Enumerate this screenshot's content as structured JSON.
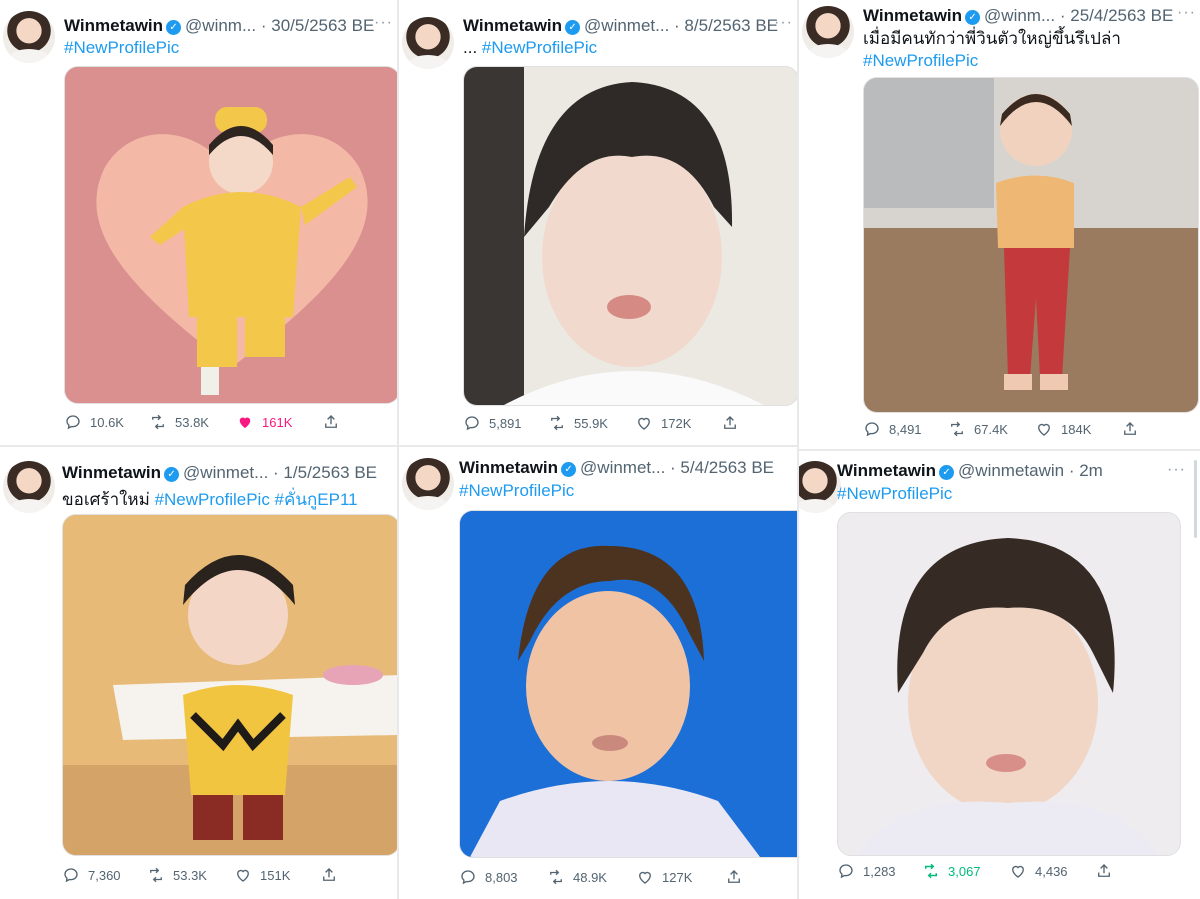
{
  "tweets": [
    {
      "name": "Winmetawin",
      "handle": "@winm...",
      "date": "· 30/5/2563 BE",
      "text_prefix": "",
      "hashtags": "#NewProfilePic",
      "stats": {
        "replies": "10.6K",
        "retweets": "53.8K",
        "likes": "161K"
      },
      "liked": true,
      "retweeted": false
    },
    {
      "name": "Winmetawin",
      "handle": "@winmet...",
      "date": "· 8/5/2563 BE",
      "text_prefix": "...",
      "hashtags": "#NewProfilePic",
      "stats": {
        "replies": "5,891",
        "retweets": "55.9K",
        "likes": "172K"
      },
      "liked": false,
      "retweeted": false
    },
    {
      "name": "Winmetawin",
      "handle": "@winm...",
      "date": "· 25/4/2563 BE",
      "text_prefix": "เมื่อมีคนทักว่าพี่วินตัวใหญ่ขึ้นรึเปล่า",
      "hashtags": "#NewProfilePic",
      "stats": {
        "replies": "8,491",
        "retweets": "67.4K",
        "likes": "184K"
      },
      "liked": false,
      "retweeted": false
    },
    {
      "name": "Winmetawin",
      "handle": "@winmet...",
      "date": "· 1/5/2563 BE",
      "text_prefix": "ขอเศร้าใหม่",
      "hashtags": "#NewProfilePic #คั่นกูEP11",
      "stats": {
        "replies": "7,360",
        "retweets": "53.3K",
        "likes": "151K"
      },
      "liked": false,
      "retweeted": false
    },
    {
      "name": "Winmetawin",
      "handle": "@winmet...",
      "date": "· 5/4/2563 BE",
      "text_prefix": "",
      "hashtags": "#NewProfilePic",
      "stats": {
        "replies": "8,803",
        "retweets": "48.9K",
        "likes": "127K"
      },
      "liked": false,
      "retweeted": false
    },
    {
      "name": "Winmetawin",
      "handle": "@winmetawin",
      "date": "· 2m",
      "text_prefix": "",
      "hashtags": "#NewProfilePic",
      "stats": {
        "replies": "1,283",
        "retweets": "3,067",
        "likes": "4,436"
      },
      "liked": false,
      "retweeted": true
    }
  ],
  "colors": {
    "accent": "#1d9bf0",
    "like": "#f91880",
    "retweet": "#00ba7c"
  },
  "icons": [
    "verified-badge-icon",
    "more-icon",
    "reply-icon",
    "retweet-icon",
    "like-icon",
    "share-icon"
  ]
}
